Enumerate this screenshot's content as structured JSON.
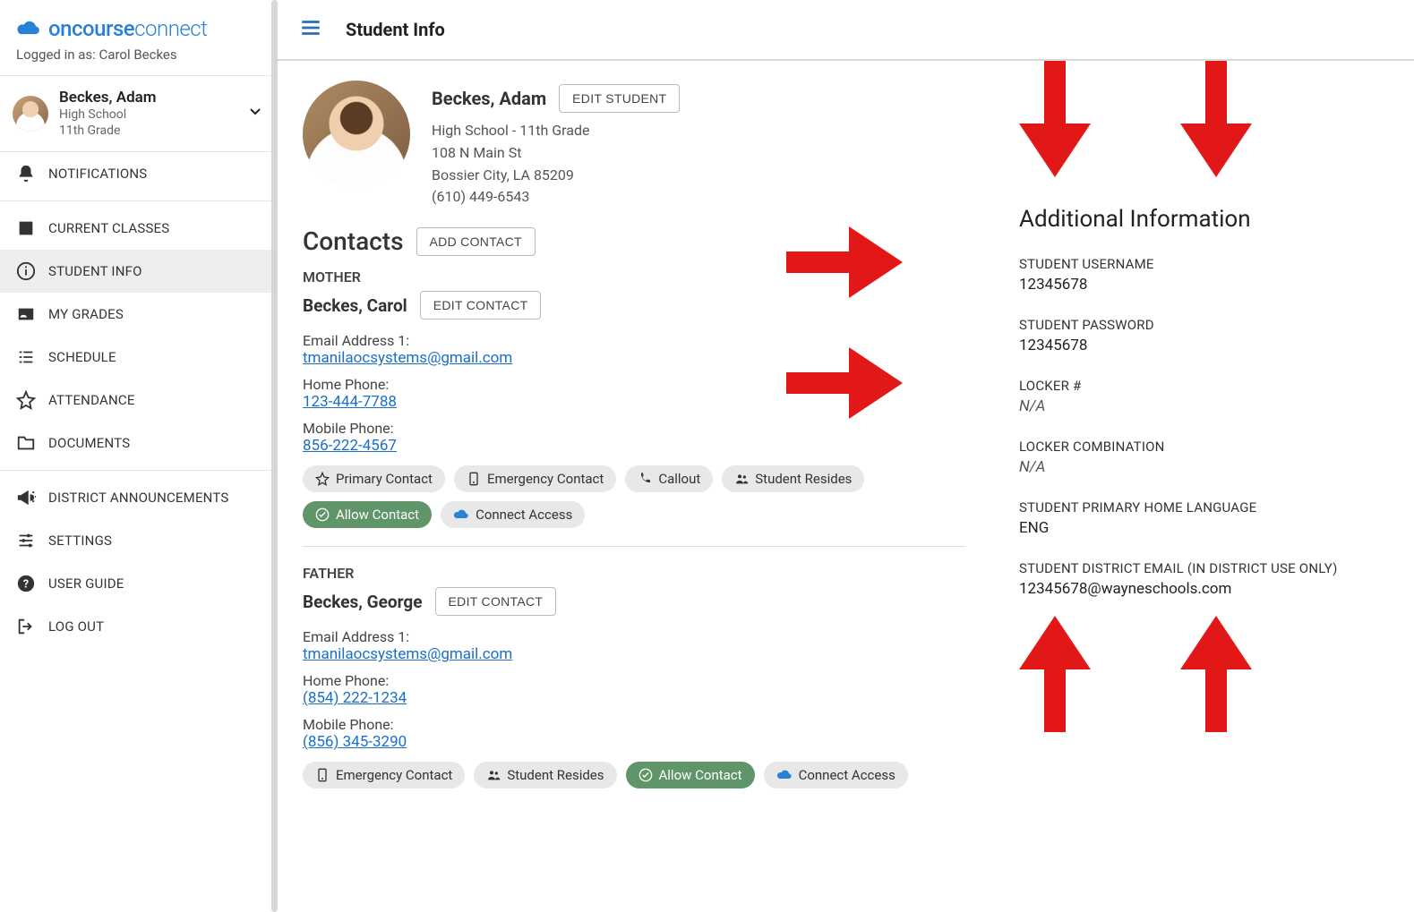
{
  "brand": {
    "name_bold": "oncourse",
    "name_thin": "connect"
  },
  "logged_in_prefix": "Logged in as: ",
  "logged_in_user": "Carol Beckes",
  "picker": {
    "name": "Beckes, Adam",
    "school": "High School",
    "grade": "11th Grade"
  },
  "nav": {
    "notifications": "NOTIFICATIONS",
    "current_classes": "CURRENT CLASSES",
    "student_info": "STUDENT INFO",
    "my_grades": "MY GRADES",
    "schedule": "SCHEDULE",
    "attendance": "ATTENDANCE",
    "documents": "DOCUMENTS",
    "district_announcements": "DISTRICT ANNOUNCEMENTS",
    "settings": "SETTINGS",
    "user_guide": "USER GUIDE",
    "log_out": "LOG OUT"
  },
  "page_title": "Student Info",
  "student": {
    "name": "Beckes, Adam",
    "edit_label": "EDIT STUDENT",
    "school_grade": "High School - 11th Grade",
    "address1": "108 N Main St",
    "address2": "Bossier City, LA 85209",
    "phone": "(610) 449-6543"
  },
  "contacts_title": "Contacts",
  "add_contact_label": "ADD CONTACT",
  "edit_contact_label": "EDIT CONTACT",
  "field_labels": {
    "email1": "Email Address 1:",
    "home_phone": "Home Phone:",
    "mobile_phone": "Mobile Phone:"
  },
  "chips": {
    "primary_contact": "Primary Contact",
    "emergency_contact": "Emergency Contact",
    "callout": "Callout",
    "student_resides": "Student Resides",
    "allow_contact": "Allow Contact",
    "connect_access": "Connect Access"
  },
  "contacts": [
    {
      "role": "MOTHER",
      "name": "Beckes, Carol",
      "email": "tmanilaocsystems@gmail.com",
      "home_phone": "123-444-7788",
      "mobile_phone": "856-222-4567"
    },
    {
      "role": "FATHER",
      "name": "Beckes, George",
      "email": "tmanilaocsystems@gmail.com",
      "home_phone": "(854) 222-1234",
      "mobile_phone": "(856) 345-3290"
    }
  ],
  "additional": {
    "title": "Additional Information",
    "fields": [
      {
        "label": "STUDENT USERNAME",
        "value": "12345678",
        "italic": false
      },
      {
        "label": "STUDENT PASSWORD",
        "value": "12345678",
        "italic": false
      },
      {
        "label": "LOCKER #",
        "value": "N/A",
        "italic": true
      },
      {
        "label": "LOCKER COMBINATION",
        "value": "N/A",
        "italic": true
      },
      {
        "label": "STUDENT PRIMARY HOME LANGUAGE",
        "value": "ENG",
        "italic": false
      },
      {
        "label": "STUDENT DISTRICT EMAIL (IN DISTRICT USE ONLY)",
        "value": "12345678@wayneschools.com",
        "italic": false
      }
    ]
  }
}
